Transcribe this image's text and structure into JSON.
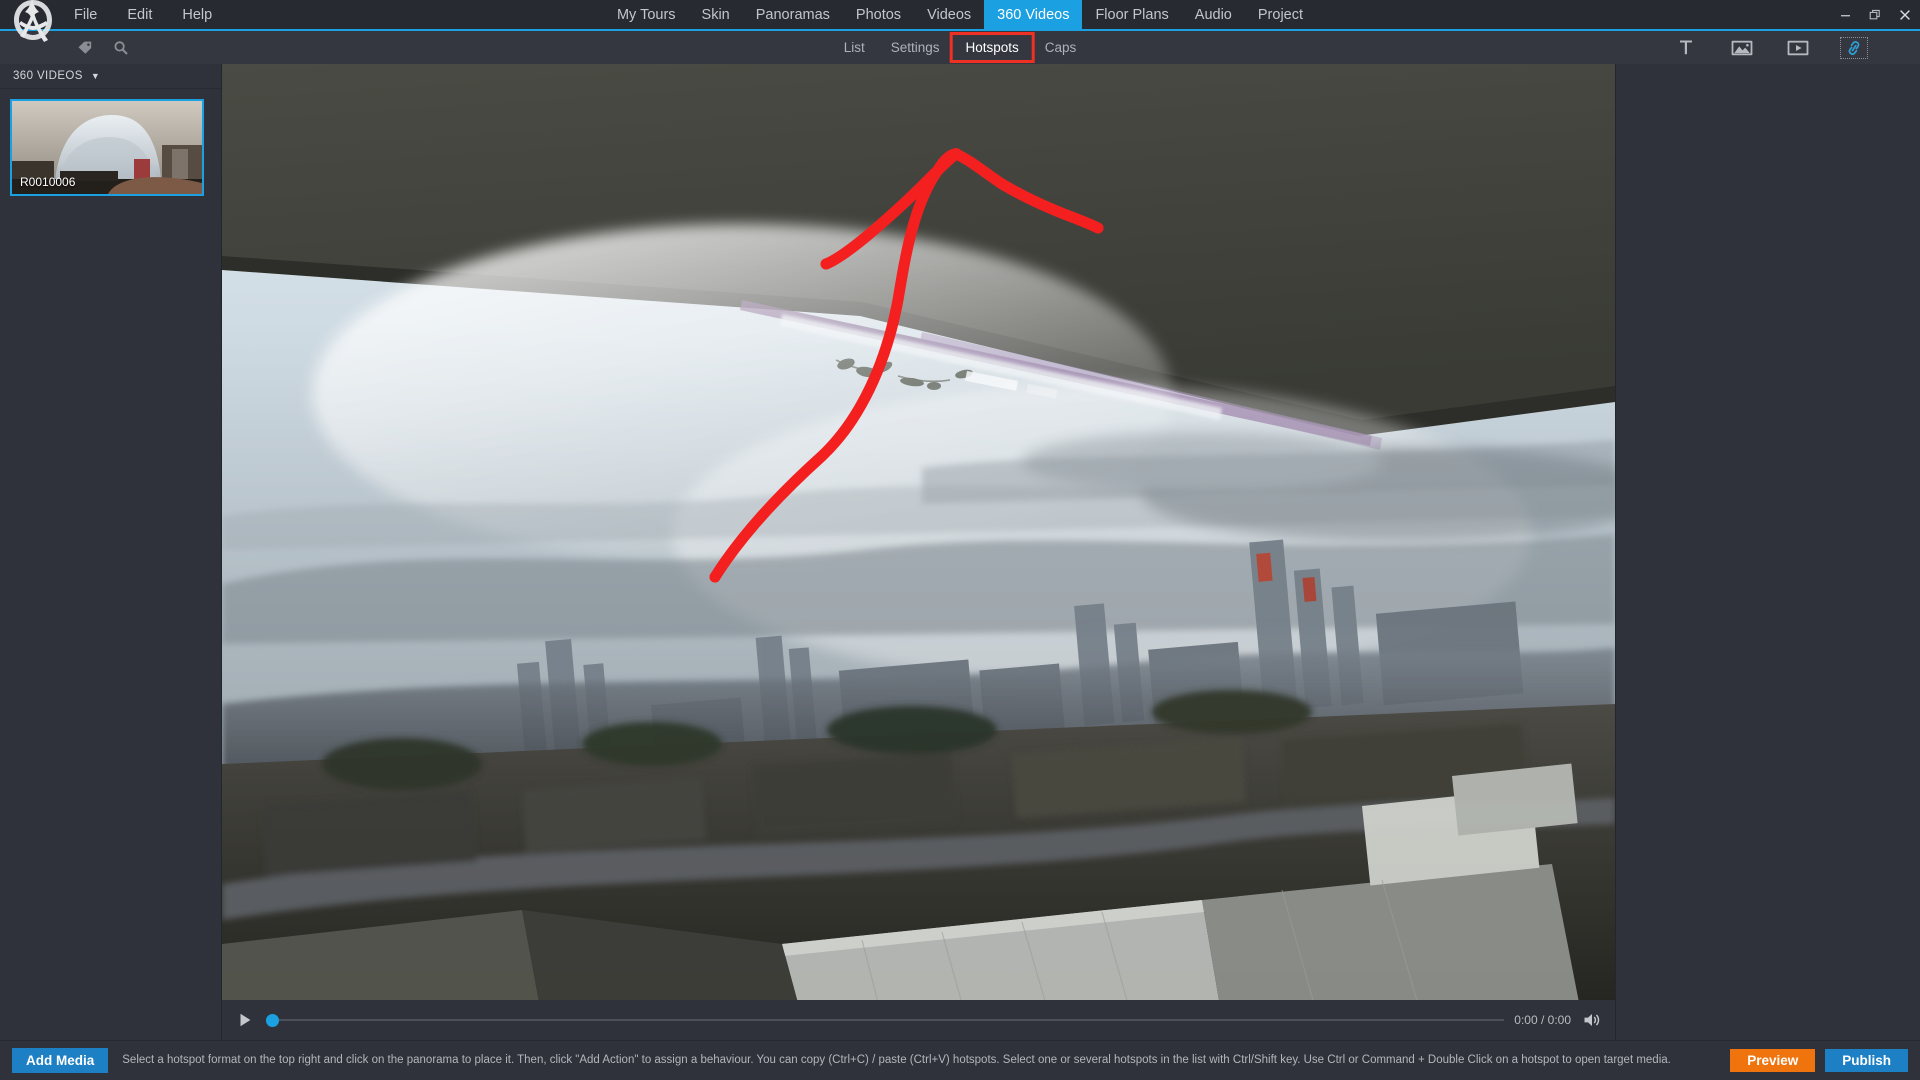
{
  "window": {
    "controls": [
      {
        "name": "minimize",
        "glyph": "minimize-icon"
      },
      {
        "name": "restore",
        "glyph": "restore-icon"
      },
      {
        "name": "close",
        "glyph": "close-icon"
      }
    ]
  },
  "menubar": {
    "logo": "panotour-logo-icon",
    "items": [
      {
        "label": "File"
      },
      {
        "label": "Edit"
      },
      {
        "label": "Help"
      }
    ]
  },
  "top_tabs": {
    "active": "360 Videos",
    "items": [
      {
        "label": "My Tours"
      },
      {
        "label": "Skin"
      },
      {
        "label": "Panoramas"
      },
      {
        "label": "Photos"
      },
      {
        "label": "Videos"
      },
      {
        "label": "360 Videos"
      },
      {
        "label": "Floor Plans"
      },
      {
        "label": "Audio"
      },
      {
        "label": "Project"
      }
    ]
  },
  "subbar": {
    "left_icons": [
      {
        "name": "tag-icon"
      },
      {
        "name": "search-icon"
      }
    ],
    "tabs": [
      {
        "label": "List",
        "active": false,
        "highlighted": false
      },
      {
        "label": "Settings",
        "active": false,
        "highlighted": false
      },
      {
        "label": "Hotspots",
        "active": true,
        "highlighted": true
      },
      {
        "label": "Caps",
        "active": false,
        "highlighted": false
      }
    ],
    "tools": [
      {
        "name": "text-hotspot-icon",
        "glyph": "T",
        "selected": false
      },
      {
        "name": "image-hotspot-icon",
        "glyph": "image",
        "selected": false
      },
      {
        "name": "video-hotspot-icon",
        "glyph": "video",
        "selected": false
      },
      {
        "name": "link-hotspot-icon",
        "glyph": "link",
        "selected": true
      }
    ]
  },
  "left_panel": {
    "header": "360 VIDEOS",
    "caret": "▼",
    "items": [
      {
        "label": "R0010006",
        "selected": true
      }
    ]
  },
  "player": {
    "play_label": "play-icon",
    "time": "0:00 / 0:00",
    "progress_percent": 0,
    "volume_label": "volume-icon"
  },
  "bottom_bar": {
    "add_media_label": "Add Media",
    "hint": "Select a hotspot format on the top right and click on the panorama to place it. Then, click \"Add Action\" to assign a behaviour. You can copy (Ctrl+C) / paste (Ctrl+V) hotspots. Select one or several hotspots in the list with Ctrl/Shift key. Use Ctrl or Command + Double Click on a hotspot to open target media.",
    "preview_label": "Preview",
    "publish_label": "Publish"
  },
  "annotation": {
    "type": "hand-drawn-arrow",
    "color": "#f42020",
    "points_note": "curved upward arrow pointing to the Hotspots tab"
  },
  "colors": {
    "accent": "#1ba1e2",
    "highlight_box": "#ef3124",
    "preview": "#f0740d",
    "publish": "#1d7fc4",
    "panel_bg": "#2f323a",
    "titlebar_bg": "#272a31"
  }
}
